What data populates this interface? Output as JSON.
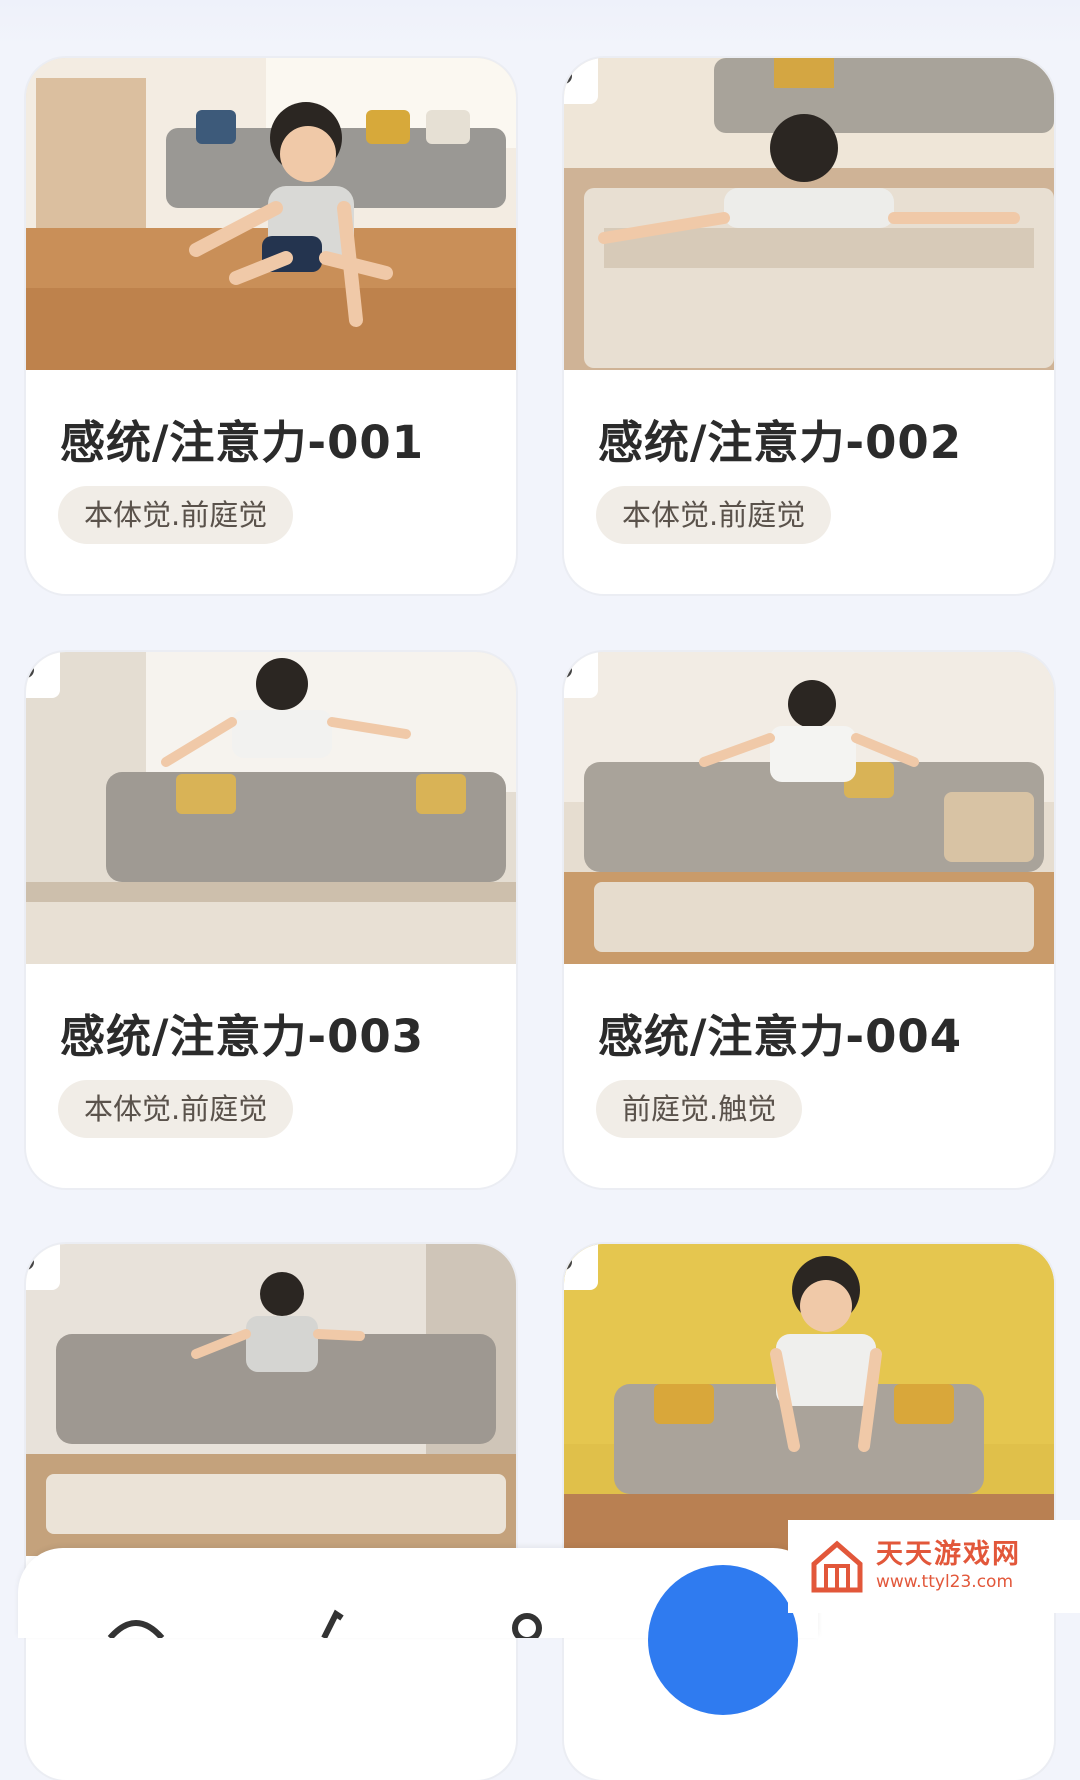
{
  "cards": [
    {
      "title": "感统/注意力-001",
      "tag": "本体觉.前庭觉",
      "locked": false,
      "scene": "warm"
    },
    {
      "title": "感统/注意力-002",
      "tag": "本体觉.前庭觉",
      "locked": true,
      "scene": "rug"
    },
    {
      "title": "感统/注意力-003",
      "tag": "本体觉.前庭觉",
      "locked": true,
      "scene": "sofa"
    },
    {
      "title": "感统/注意力-004",
      "tag": "前庭觉.触觉",
      "locked": true,
      "scene": "sofa2"
    },
    {
      "title": "",
      "tag": "",
      "locked": true,
      "scene": "sofa3"
    },
    {
      "title": "",
      "tag": "",
      "locked": true,
      "scene": "yellow"
    }
  ],
  "watermark": {
    "name": "天天游戏网",
    "url": "www.ttyl23.com"
  },
  "colors": {
    "background": "#f2f4fb",
    "tag_bg": "#f1ede7",
    "accent": "#2f7bf0",
    "watermark": "#e2573a"
  }
}
